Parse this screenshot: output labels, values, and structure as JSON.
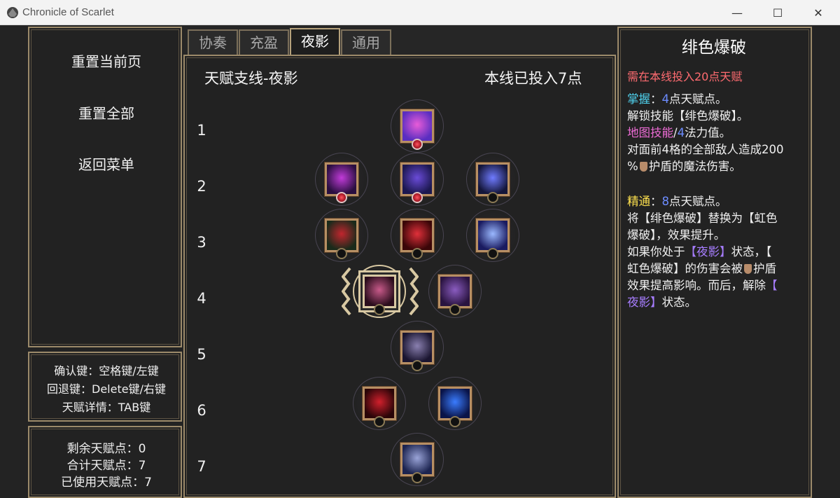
{
  "window": {
    "title": "Chronicle of Scarlet",
    "minimize": "—",
    "maximize": "☐",
    "close": "✕"
  },
  "left_menu": {
    "reset_page": "重置当前页",
    "reset_all": "重置全部",
    "back_menu": "返回菜单"
  },
  "keys": {
    "confirm": "确认键：空格键/左键",
    "back": "回退键：Delete键/右键",
    "detail": "天赋详情：TAB键"
  },
  "points": {
    "remaining": "剩余天赋点：0",
    "total": "合计天赋点：7",
    "used": "已使用天赋点：7"
  },
  "tabs": [
    {
      "label": "协奏",
      "active": false
    },
    {
      "label": "充盈",
      "active": false
    },
    {
      "label": "夜影",
      "active": true
    },
    {
      "label": "通用",
      "active": false
    }
  ],
  "tree": {
    "branch_title": "天赋支线-夜影",
    "invested": "本线已投入7点",
    "rows": [
      "1",
      "2",
      "3",
      "4",
      "5",
      "6",
      "7"
    ]
  },
  "nodes": [
    {
      "name": "node-crescent-moon",
      "icon": "crescent-moon-icon",
      "color_a": "#5a2ec0",
      "color_b": "#e85cd8",
      "invested": true
    },
    {
      "name": "node-dark-eye",
      "icon": "dark-eye-icon",
      "color_a": "#2a0f40",
      "color_b": "#c13bd9",
      "invested": true
    },
    {
      "name": "node-shadow-swirl",
      "icon": "shadow-swirl-icon",
      "color_a": "#1c1850",
      "color_b": "#6a4bd8",
      "invested": true
    },
    {
      "name": "node-blue-ring",
      "icon": "blue-ring-icon",
      "color_a": "#14163a",
      "color_b": "#6f7bff",
      "invested": false
    },
    {
      "name": "node-red-leaf",
      "icon": "red-leaf-icon",
      "color_a": "#1a2a1a",
      "color_b": "#c0262e",
      "invested": false
    },
    {
      "name": "node-blood-orb",
      "icon": "blood-orb-icon",
      "color_a": "#3a0608",
      "color_b": "#e0303a",
      "invested": false
    },
    {
      "name": "node-ice-blade",
      "icon": "ice-blade-icon",
      "color_a": "#1a1b60",
      "color_b": "#9ab8ff",
      "invested": false
    },
    {
      "name": "node-scarlet-burst",
      "icon": "slash-icon",
      "color_a": "#2a0d1c",
      "color_b": "#c85a8a",
      "invested": false,
      "selected": true
    },
    {
      "name": "node-purple-book",
      "icon": "book-icon",
      "color_a": "#2a1440",
      "color_b": "#8a5cc0",
      "invested": false
    },
    {
      "name": "node-dark-sword",
      "icon": "sword-icon",
      "color_a": "#1a1530",
      "color_b": "#8a80b0",
      "invested": false
    },
    {
      "name": "node-crimson-fire",
      "icon": "fire-icon",
      "color_a": "#2a0508",
      "color_b": "#d0202c",
      "invested": false
    },
    {
      "name": "node-blue-cracks",
      "icon": "cracks-icon",
      "color_a": "#0a1448",
      "color_b": "#3a7cff",
      "invested": false
    },
    {
      "name": "node-meteor",
      "icon": "meteor-icon",
      "color_a": "#1c2450",
      "color_b": "#9aa4d8",
      "invested": false
    }
  ],
  "detail": {
    "title": "绯色爆破",
    "requirement": "需在本线投入20点天赋",
    "grasp_label": "掌握",
    "grasp_sep": "：",
    "grasp_value": "4",
    "grasp_rest": "点天赋点。",
    "unlock_line": "解锁技能【绯色爆破】。",
    "map_skill_label": "地图技能",
    "map_skill_slash": "/",
    "map_skill_value": "4",
    "map_skill_rest": "法力值。",
    "damage_line1": "对面前4格的全部敌人造成200",
    "damage_line2_a": "%",
    "damage_line2_b": "护盾的魔法伤害。",
    "master_label": "精通",
    "master_sep": "：",
    "master_value": "8",
    "master_rest": "点天赋点。",
    "replace_line1": "将【绯色爆破】替换为【虹色",
    "replace_line2": "爆破】，效果提升。",
    "cond_line_a": "如果你处于",
    "cond_line_b": "【夜影】",
    "cond_line_c": "状态，【",
    "effect_line_a": "虹色爆破】的伤害会被",
    "effect_line_b": "护盾",
    "effect_line3": "效果提高影响。而后，解除",
    "effect_line3_b": "【",
    "effect_line4_a": "夜影】",
    "effect_line4_b": "状态。"
  },
  "colors": {
    "frame": "#9c8a6a",
    "background": "#222222",
    "accent_red": "#ff6b70"
  }
}
